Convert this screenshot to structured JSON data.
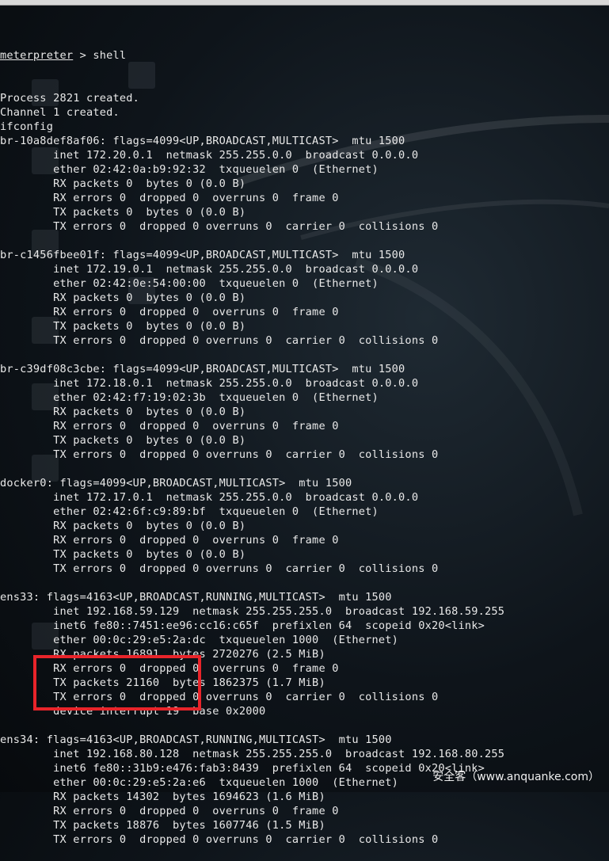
{
  "terminal": {
    "prompt": "meterpreter",
    "command": " > shell",
    "lines": [
      "Process 2821 created.",
      "Channel 1 created.",
      "ifconfig",
      "br-10a8def8af06: flags=4099<UP,BROADCAST,MULTICAST>  mtu 1500",
      "        inet 172.20.0.1  netmask 255.255.0.0  broadcast 0.0.0.0",
      "        ether 02:42:0a:b9:92:32  txqueuelen 0  (Ethernet)",
      "        RX packets 0  bytes 0 (0.0 B)",
      "        RX errors 0  dropped 0  overruns 0  frame 0",
      "        TX packets 0  bytes 0 (0.0 B)",
      "        TX errors 0  dropped 0 overruns 0  carrier 0  collisions 0",
      "",
      "br-c1456fbee01f: flags=4099<UP,BROADCAST,MULTICAST>  mtu 1500",
      "        inet 172.19.0.1  netmask 255.255.0.0  broadcast 0.0.0.0",
      "        ether 02:42:0e:54:00:00  txqueuelen 0  (Ethernet)",
      "        RX packets 0  bytes 0 (0.0 B)",
      "        RX errors 0  dropped 0  overruns 0  frame 0",
      "        TX packets 0  bytes 0 (0.0 B)",
      "        TX errors 0  dropped 0 overruns 0  carrier 0  collisions 0",
      "",
      "br-c39df08c3cbe: flags=4099<UP,BROADCAST,MULTICAST>  mtu 1500",
      "        inet 172.18.0.1  netmask 255.255.0.0  broadcast 0.0.0.0",
      "        ether 02:42:f7:19:02:3b  txqueuelen 0  (Ethernet)",
      "        RX packets 0  bytes 0 (0.0 B)",
      "        RX errors 0  dropped 0  overruns 0  frame 0",
      "        TX packets 0  bytes 0 (0.0 B)",
      "        TX errors 0  dropped 0 overruns 0  carrier 0  collisions 0",
      "",
      "docker0: flags=4099<UP,BROADCAST,MULTICAST>  mtu 1500",
      "        inet 172.17.0.1  netmask 255.255.0.0  broadcast 0.0.0.0",
      "        ether 02:42:6f:c9:89:bf  txqueuelen 0  (Ethernet)",
      "        RX packets 0  bytes 0 (0.0 B)",
      "        RX errors 0  dropped 0  overruns 0  frame 0",
      "        TX packets 0  bytes 0 (0.0 B)",
      "        TX errors 0  dropped 0 overruns 0  carrier 0  collisions 0",
      "",
      "ens33: flags=4163<UP,BROADCAST,RUNNING,MULTICAST>  mtu 1500",
      "        inet 192.168.59.129  netmask 255.255.255.0  broadcast 192.168.59.255",
      "        inet6 fe80::7451:ee96:cc16:c65f  prefixlen 64  scopeid 0x20<link>",
      "        ether 00:0c:29:e5:2a:dc  txqueuelen 1000  (Ethernet)",
      "        RX packets 16891  bytes 2720276 (2.5 MiB)",
      "        RX errors 0  dropped 0  overruns 0  frame 0",
      "        TX packets 21160  bytes 1862375 (1.7 MiB)",
      "        TX errors 0  dropped 0 overruns 0  carrier 0  collisions 0",
      "        device interrupt 19  base 0x2000",
      "",
      "ens34: flags=4163<UP,BROADCAST,RUNNING,MULTICAST>  mtu 1500",
      "        inet 192.168.80.128  netmask 255.255.255.0  broadcast 192.168.80.255",
      "        inet6 fe80::31b9:e476:fab3:8439  prefixlen 64  scopeid 0x20<link>",
      "        ether 00:0c:29:e5:2a:e6  txqueuelen 1000  (Ethernet)",
      "        RX packets 14302  bytes 1694623 (1.6 MiB)",
      "        RX errors 0  dropped 0  overruns 0  frame 0",
      "        TX packets 18876  bytes 1607746 (1.5 MiB)",
      "        TX errors 0  dropped 0 overruns 0  carrier 0  collisions 0"
    ]
  },
  "watermark": "安全客（www.anquanke.com）",
  "colors": {
    "text": "#e9e9e9",
    "highlight": "#e8242a",
    "background": "#0e141a"
  }
}
